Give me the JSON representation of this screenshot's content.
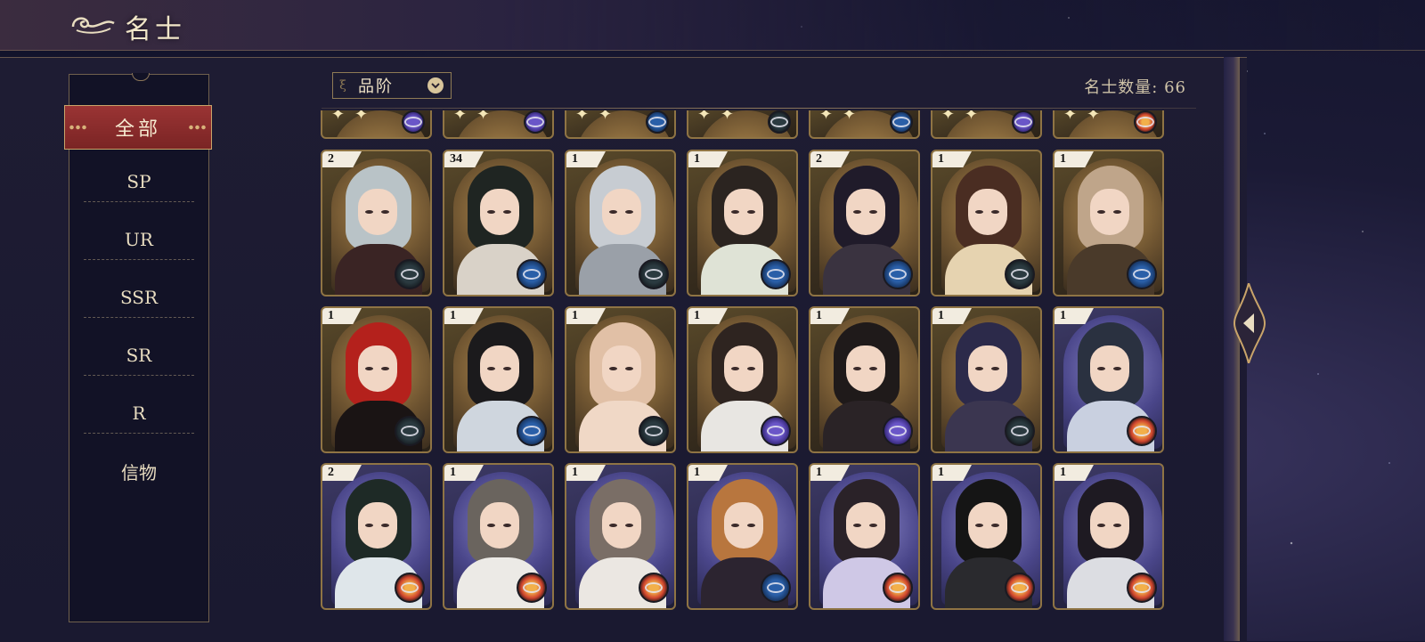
{
  "header": {
    "title": "名士"
  },
  "sidebar": {
    "active": "全部",
    "items": [
      "SP",
      "UR",
      "SSR",
      "SR",
      "R",
      "信物"
    ]
  },
  "filter": {
    "label": "品阶"
  },
  "count": {
    "text": "名士数量: 66"
  },
  "colors": {
    "accent_red": "#8e2e2e",
    "gold_border": "#8f7444",
    "panel_bg": "#1e1c33"
  },
  "cards": {
    "top_partial": [
      {
        "frame": "gold",
        "icon": "purple",
        "count": ""
      },
      {
        "frame": "gold",
        "icon": "purple",
        "count": ""
      },
      {
        "frame": "gold",
        "icon": "blue",
        "count": ""
      },
      {
        "frame": "gold",
        "icon": "silver",
        "count": ""
      },
      {
        "frame": "gold",
        "icon": "blue",
        "count": ""
      },
      {
        "frame": "gold",
        "icon": "purple",
        "count": ""
      },
      {
        "frame": "gold",
        "icon": "orange",
        "count": ""
      }
    ],
    "rows": [
      [
        {
          "count": "2",
          "frame": "gold",
          "icon": "silver",
          "hair": "#b9c3c7",
          "clothes": "#3a2424"
        },
        {
          "count": "34",
          "frame": "gold",
          "icon": "blue",
          "hair": "#1f2522",
          "clothes": "#d9d2c8"
        },
        {
          "count": "1",
          "frame": "gold",
          "icon": "silver",
          "hair": "#c7ccd2",
          "clothes": "#9aa0a8"
        },
        {
          "count": "1",
          "frame": "gold",
          "icon": "blue",
          "hair": "#2b2420",
          "clothes": "#dfe3d6"
        },
        {
          "count": "2",
          "frame": "gold",
          "icon": "blue",
          "hair": "#201b2a",
          "clothes": "#3a3340"
        },
        {
          "count": "1",
          "frame": "gold",
          "icon": "silver",
          "hair": "#4a2d22",
          "clothes": "#e6d3b0"
        },
        {
          "count": "1",
          "frame": "gold",
          "icon": "blue",
          "hair": "#bfa58a",
          "clothes": "#4a3a2a"
        }
      ],
      [
        {
          "count": "1",
          "frame": "gold",
          "icon": "silver",
          "hair": "#b4211c",
          "clothes": "#1a1414"
        },
        {
          "count": "1",
          "frame": "gold",
          "icon": "blue",
          "hair": "#1b1a1c",
          "clothes": "#cfd6de"
        },
        {
          "count": "1",
          "frame": "gold",
          "icon": "silver",
          "hair": "#e1c0a6",
          "clothes": "#f0d8c6"
        },
        {
          "count": "1",
          "frame": "gold",
          "icon": "purple",
          "hair": "#2e2420",
          "clothes": "#e8e6e2"
        },
        {
          "count": "1",
          "frame": "gold",
          "icon": "purple",
          "hair": "#1f1a1a",
          "clothes": "#2a2326"
        },
        {
          "count": "1",
          "frame": "gold",
          "icon": "silver",
          "hair": "#2c2a4a",
          "clothes": "#3b3650"
        },
        {
          "count": "1",
          "frame": "purple",
          "icon": "orange",
          "hair": "#2a3140",
          "clothes": "#c9d0e0"
        }
      ],
      [
        {
          "count": "2",
          "frame": "purple",
          "icon": "orange",
          "hair": "#1e2a26",
          "clothes": "#dfe6ea"
        },
        {
          "count": "1",
          "frame": "purple",
          "icon": "orange",
          "hair": "#6a645e",
          "clothes": "#eceae6"
        },
        {
          "count": "1",
          "frame": "purple",
          "icon": "orange",
          "hair": "#7a6e66",
          "clothes": "#ebe7e2"
        },
        {
          "count": "1",
          "frame": "purple",
          "icon": "blue",
          "hair": "#b8763e",
          "clothes": "#2c2430"
        },
        {
          "count": "1",
          "frame": "purple",
          "icon": "orange",
          "hair": "#2a2228",
          "clothes": "#cfc8e6"
        },
        {
          "count": "1",
          "frame": "purple",
          "icon": "orange",
          "hair": "#151515",
          "clothes": "#2a2a2e"
        },
        {
          "count": "1",
          "frame": "purple",
          "icon": "orange",
          "hair": "#1e1a22",
          "clothes": "#dcdde2"
        }
      ]
    ]
  }
}
